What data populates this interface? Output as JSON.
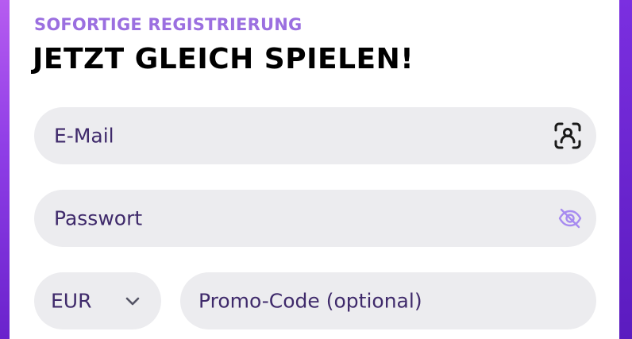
{
  "form": {
    "subtitle": "SOFORTIGE REGISTRIERUNG",
    "title": "JETZT GLEICH SPIELEN!",
    "email": {
      "placeholder": "E-Mail",
      "icon": "face-scan-icon"
    },
    "password": {
      "placeholder": "Passwort",
      "icon": "eye-off-icon"
    },
    "currency": {
      "selected": "EUR",
      "icon": "chevron-down-icon"
    },
    "promo": {
      "placeholder": "Promo-Code (optional)"
    }
  },
  "colors": {
    "accent": "#9b6fe0",
    "title": "#000000",
    "field_bg": "#ececef",
    "field_text": "#3f2a6b",
    "eye_icon": "#a78bf0",
    "background": "#7b2fe0"
  }
}
